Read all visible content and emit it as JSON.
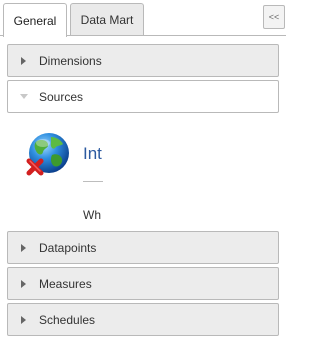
{
  "tabs": [
    {
      "label": "General",
      "active": true
    },
    {
      "label": "Data Mart",
      "active": false
    }
  ],
  "collapse_button": {
    "label": "<<"
  },
  "sections": [
    {
      "label": "Dimensions",
      "expanded": false
    },
    {
      "label": "Sources",
      "expanded": true
    },
    {
      "label": "Datapoints",
      "expanded": false
    },
    {
      "label": "Measures",
      "expanded": false
    },
    {
      "label": "Schedules",
      "expanded": false
    }
  ],
  "sources_panel": {
    "icon": "globe-error-icon",
    "title": "Int",
    "description": "Wh"
  },
  "colors": {
    "accent_text": "#2c5aa0",
    "border": "#b9b9b9",
    "header_bg": "#ececec"
  }
}
